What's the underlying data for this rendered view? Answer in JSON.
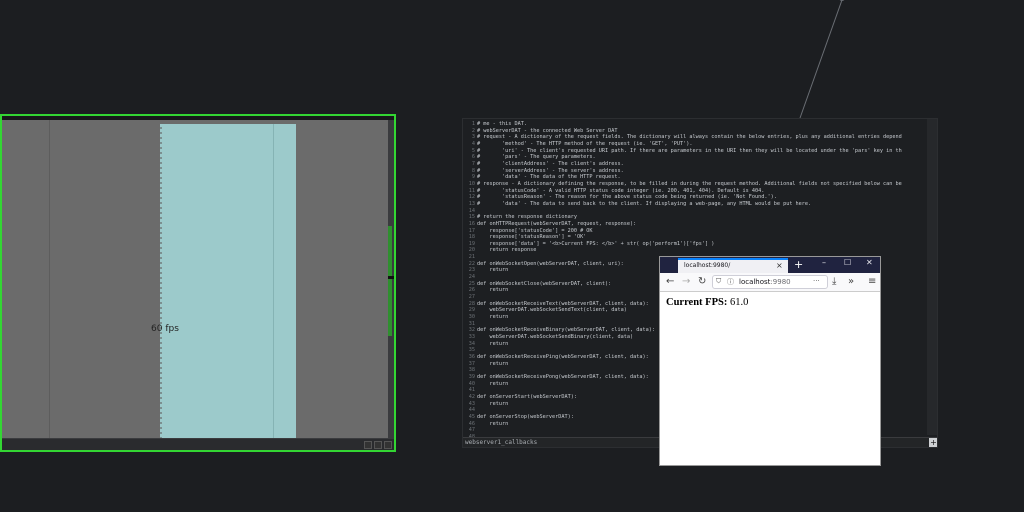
{
  "colors": {
    "background": "#1c1e21",
    "selection_green": "#33d633",
    "chart_cyan": "#9ccacb",
    "browser_accent": "#0a84ff"
  },
  "perform_node": {
    "fps_label": "60 fps"
  },
  "dat_node": {
    "name": "webserver1_callbacks",
    "add_icon": "+",
    "code_lines": [
      "# me - this DAT.",
      "# webServerDAT - the connected Web Server DAT",
      "# request - A dictionary of the request fields. The dictionary will always contain the below entries, plus any additional entries depend",
      "#       'method' - The HTTP method of the request (ie. 'GET', 'PUT').",
      "#       'uri' - The client's requested URI path. If there are parameters in the URI then they will be located under the 'pars' key in th",
      "#       'pars' - The query parameters.",
      "#       'clientAddress' - The client's address.",
      "#       'serverAddress' - The server's address.",
      "#       'data' - The data of the HTTP request.",
      "# response - A dictionary defining the response, to be filled in during the request method. Additional fields not specified below can be",
      "#       'statusCode' - A valid HTTP status code integer (ie. 200, 401, 404). Default is 404.",
      "#       'statusReason' - The reason for the above status code being returned (ie. 'Not Found.').",
      "#       'data' - The data to send back to the client. If displaying a web-page, any HTML would be put here.",
      "",
      "# return the response dictionary",
      "def onHTTPRequest(webServerDAT, request, response):",
      "    response['statusCode'] = 200 # OK",
      "    response['statusReason'] = 'OK'",
      "    response['data'] = '<b>Current FPS: </b>' + str( op('perform1')['fps'] )",
      "    return response",
      "",
      "def onWebSocketOpen(webServerDAT, client, uri):",
      "    return",
      "",
      "def onWebSocketClose(webServerDAT, client):",
      "    return",
      "",
      "def onWebSocketReceiveText(webServerDAT, client, data):",
      "    webServerDAT.webSocketSendText(client, data)",
      "    return",
      "",
      "def onWebSocketReceiveBinary(webServerDAT, client, data):",
      "    webServerDAT.webSocketSendBinary(client, data)",
      "    return",
      "",
      "def onWebSocketReceivePing(webServerDAT, client, data):",
      "    return",
      "",
      "def onWebSocketReceivePong(webServerDAT, client, data):",
      "    return",
      "",
      "def onServerStart(webServerDAT):",
      "    return",
      "",
      "def onServerStop(webServerDAT):",
      "    return",
      "",
      "",
      "",
      "",
      "",
      ""
    ]
  },
  "browser": {
    "tab_title": "localhost:9980/",
    "tab_close": "×",
    "new_tab": "+",
    "window_buttons": {
      "minimize": "–",
      "maximize": "☐",
      "close": "✕"
    },
    "url_host": "localhost",
    "url_port": ":9980",
    "more_icon": "···",
    "page_label": "Current FPS:",
    "page_value": " 61.0"
  }
}
